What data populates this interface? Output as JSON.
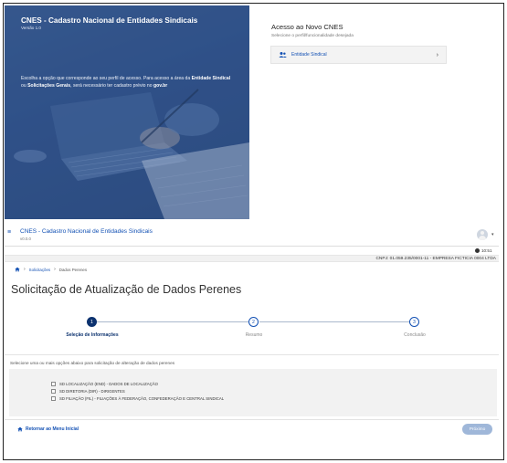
{
  "hero": {
    "title": "CNES - Cadastro Nacional de Entidades Sindicais",
    "version": "Versão 1.0",
    "text_prefix": "Escolha a opção que corresponde ao seu perfil de acesso. Para acesso a área da ",
    "text_bold1": "Entidade Sindical",
    "text_mid": " ou ",
    "text_bold2": "Solicitações Gerais",
    "text_suffix": ", será necessário ter cadastro prévio no ",
    "text_bold3": "gov.br"
  },
  "access": {
    "title": "Acesso ao Novo CNES",
    "subtitle": "Selecione o perfil/funcionalidade desejada",
    "profile_label": "Entidade Sindical",
    "profile_icon": "users-icon",
    "chevron": "›"
  },
  "header": {
    "menu_glyph": "≡",
    "title": "CNES - Cadastro Nacional de Entidades Sindicais",
    "version": "v0.0.0",
    "caret": "▾",
    "time": "10:51",
    "cnpj": "CNPJ: 01.059.235/0001-11 - EMPRESA FICTICIA 0004 LTDA"
  },
  "breadcrumb": {
    "sep": "›",
    "items": [
      "Solicitações",
      "Dados Perenes"
    ]
  },
  "page": {
    "title": "Solicitação de Atualização de Dados Perenes"
  },
  "steps": [
    {
      "num": "1",
      "label": "Seleção de Informações",
      "state": "active"
    },
    {
      "num": "2",
      "label": "Resumo",
      "state": "idle"
    },
    {
      "num": "3",
      "label": "Conclusão",
      "state": "idle"
    }
  ],
  "instructions": "Selecione uma ou mais opções abaixo para solicitação de alteração de dados perenes",
  "options": [
    {
      "label": "SD LOCALIZAÇÃO (END) - DADOS DE LOCALIZAÇÃO",
      "checked": false
    },
    {
      "label": "SD DIRETORIA (DIR) - DIRIGENTES",
      "checked": false
    },
    {
      "label": "SD FILIAÇÃO (FIL) - FILIAÇÕES À FEDERAÇÃO, CONFEDERAÇÃO E CENTRAL SINDICAL",
      "checked": false
    }
  ],
  "footer": {
    "back_label": "Retornar ao Menu Inicial",
    "next_label": "Próximo"
  },
  "colors": {
    "brand_blue": "#1351b4",
    "active_step": "#0c326f",
    "hero_overlay": "#2f5088",
    "disabled_button": "#9fb7d9"
  }
}
